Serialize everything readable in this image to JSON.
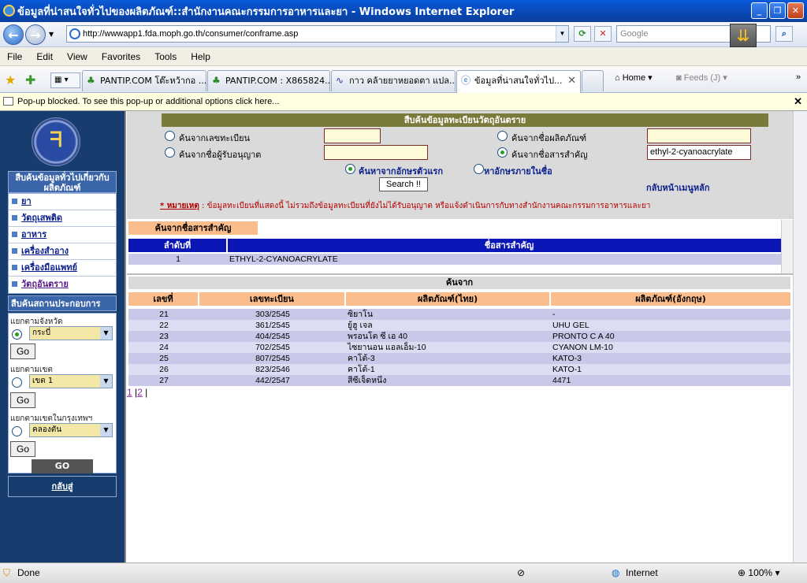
{
  "window": {
    "title": "ข้อมูลที่น่าสนใจทั่วไปของผลิตภัณฑ์::สำนักงานคณะกรรมการอาหารและยา - Windows Internet Explorer",
    "url": "http://wwwapp1.fda.moph.go.th/consumer/conframe.asp",
    "search_placeholder": "Google"
  },
  "menu": [
    "File",
    "Edit",
    "View",
    "Favorites",
    "Tools",
    "Help"
  ],
  "tabs": [
    {
      "label": "PANTIP.COM โต๊ะหว้ากอ ..."
    },
    {
      "label": "PANTIP.COM : X865824..."
    },
    {
      "label": "กาว คล้ายยาหยอดตา แปล..."
    },
    {
      "label": "ข้อมูลที่น่าสนใจทั่วไป..."
    }
  ],
  "toolbar": {
    "home": "Home",
    "feeds": "Feeds (J)"
  },
  "infobar": "Pop-up blocked. To see this pop-up or additional options click here...",
  "sidebar": {
    "header1": "สืบค้นข้อมูลทั่วไปเกี่ยวกับผลิตภัณฑ์",
    "items": [
      "ยา",
      "วัตถุเสพติด",
      "อาหาร",
      "เครื่องสำอาง",
      "เครื่องมือแพทย์",
      "วัตถุอันตราย"
    ],
    "header2": "สืบค้นสถานประกอบการ",
    "province_label": "แยกตามจังหวัด",
    "province_value": "กระบี่",
    "zone_label": "แยกตามเขต",
    "zone_value": "เขต 1",
    "bkk_label": "แยกตามเขตในกรุงเทพฯ",
    "bkk_value": "คลองตัน",
    "go": "Go",
    "go_big": "GO",
    "back": "กลับสู่"
  },
  "search": {
    "title": "สืบค้นข้อมูลทะเบียนวัตถุอันตราย",
    "opt_reg": "ค้นจากเลขทะเบียน",
    "opt_product": "ค้นจากชื่อผลิตภัณฑ์",
    "opt_licensee": "ค้นจากชื่อผู้รับอนุญาต",
    "opt_substance": "ค้นจากชื่อสารสำคัญ",
    "substance_value": "ethyl-2-cyanoacrylate",
    "mode_first": "ค้นหาจากอักษรตัวแรก",
    "mode_in": "หาอักษรภายในชื่อ",
    "button": "Search !!",
    "back_main": "กลับหน้าเมนูหลัก",
    "note_label": "* หมายเหตุ",
    "note_text": " : ข้อมูลทะเบียนที่แสดงนี้ ไม่รวมถึงข้อมูลทะเบียนที่ยังไม่ได้รับอนุญาต หรือแจ้งดำเนินการกับทางสำนักงานคณะกรรมการอาหารและยา"
  },
  "substance_table": {
    "tag": "ค้นจากชื่อสารสำคัญ",
    "col_no": "ลำดับที่",
    "col_name": "ชื่อสารสำคัญ",
    "rows": [
      {
        "no": "1",
        "name": "ETHYL-2-CYANOACRYLATE"
      }
    ]
  },
  "results": {
    "title": "ค้นจาก",
    "columns": [
      "เลขที่",
      "เลขทะเบียน",
      "ผลิตภัณฑ์(ไทย)",
      "ผลิตภัณฑ์(อังกฤษ)"
    ],
    "rows": [
      [
        "21",
        "303/2545",
        "ซิยาโน",
        "-"
      ],
      [
        "22",
        "361/2545",
        "ยู้ฮู เจล",
        "UHU GEL"
      ],
      [
        "23",
        "404/2545",
        "พรอนโต ซี เอ 40",
        "PRONTO C A 40"
      ],
      [
        "24",
        "702/2545",
        "ไซยานอน แอลเอ็ม-10",
        "CYANON LM-10"
      ],
      [
        "25",
        "807/2545",
        "คาโต้-3",
        "KATO-3"
      ],
      [
        "26",
        "823/2546",
        "คาโต้-1",
        "KATO-1"
      ],
      [
        "27",
        "442/2547",
        "สีซีเจ็ดหนึ่ง",
        "4471"
      ]
    ],
    "pages": [
      "1",
      "2"
    ]
  },
  "status": {
    "left": "Done",
    "zone": "Internet",
    "zoom": "100%"
  }
}
